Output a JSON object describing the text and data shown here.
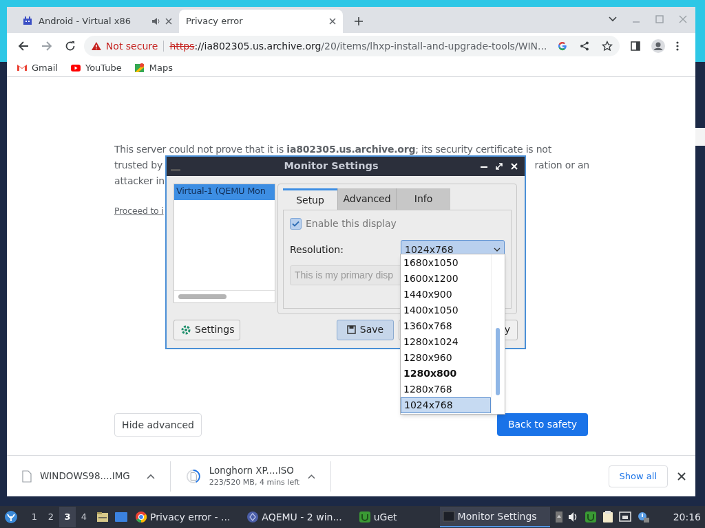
{
  "browser": {
    "tabs": [
      {
        "title": "Android - Virtual x86",
        "selected": false,
        "audio": true
      },
      {
        "title": "Privacy error",
        "selected": true,
        "audio": false
      }
    ],
    "address": {
      "security": "Not secure",
      "scheme": "https",
      "host": "://ia802305.us.archive.org",
      "path": "/20/items/lhxp-install-and-upgrade-tools/WIN..."
    },
    "bookmarks": [
      {
        "label": "Gmail",
        "kind": "gmail"
      },
      {
        "label": "YouTube",
        "kind": "youtube"
      },
      {
        "label": "Maps",
        "kind": "maps"
      }
    ]
  },
  "page": {
    "paragraph_line_1": "This server could not prove that it is **ia802305.us.archive.org**; its security certificate is not",
    "paragraph_line_2_start": "trusted by",
    "paragraph_line_2_end": "ration or an",
    "paragraph_line_3": "attacker in",
    "proceed_link": "Proceed to i",
    "hide_button": "Hide advanced",
    "safety_button": "Back to safety"
  },
  "dialog": {
    "title": "Monitor Settings",
    "monitors": [
      {
        "label": "Virtual-1 (QEMU Mon",
        "selected": true
      }
    ],
    "tabs": [
      {
        "label": "Setup",
        "selected": true
      },
      {
        "label": "Advanced",
        "selected": false
      },
      {
        "label": "Info",
        "selected": false
      }
    ],
    "enable_checkbox": {
      "label": "Enable this display",
      "checked": true
    },
    "resolution_label": "Resolution:",
    "resolution_value": "1024x768",
    "primary_button": {
      "label": "This is my primary disp",
      "disabled": true
    },
    "buttons": [
      {
        "label": "Settings",
        "kind": "settings"
      },
      {
        "label": "Save",
        "kind": "save"
      },
      {
        "label": "y",
        "kind": "apply"
      }
    ],
    "resolution_options": [
      {
        "label": "1680x1050",
        "selected": false,
        "preferred": false
      },
      {
        "label": "1600x1200",
        "selected": false,
        "preferred": false
      },
      {
        "label": "1440x900",
        "selected": false,
        "preferred": false
      },
      {
        "label": "1400x1050",
        "selected": false,
        "preferred": false
      },
      {
        "label": "1360x768",
        "selected": false,
        "preferred": false
      },
      {
        "label": "1280x1024",
        "selected": false,
        "preferred": false
      },
      {
        "label": "1280x960",
        "selected": false,
        "preferred": false
      },
      {
        "label": "1280x800",
        "selected": false,
        "preferred": true
      },
      {
        "label": "1280x768",
        "selected": false,
        "preferred": false
      },
      {
        "label": "1024x768",
        "selected": true,
        "preferred": false
      }
    ]
  },
  "downloads": {
    "items": [
      {
        "name": "WINDOWS98....IMG",
        "kind": "done"
      },
      {
        "name": "Longhorn XP....ISO",
        "status": "223/520 MB, 4 mins left",
        "kind": "progress",
        "level": 0.43
      }
    ],
    "show_all": "Show all"
  },
  "taskbar": {
    "workspaces": [
      {
        "label": "1",
        "selected": false
      },
      {
        "label": "2",
        "selected": false
      },
      {
        "label": "3",
        "selected": true
      },
      {
        "label": "4",
        "selected": false
      }
    ],
    "tasks": [
      {
        "label": "Privacy error - ...",
        "kind": "chrome",
        "selected": false
      },
      {
        "label": "AQEMU - 2 win...",
        "kind": "qemu",
        "selected": false
      },
      {
        "label": "uGet",
        "kind": "uget",
        "selected": false
      },
      {
        "label": "Monitor Settings",
        "kind": "window",
        "selected": true
      }
    ],
    "clock": "20:16"
  }
}
